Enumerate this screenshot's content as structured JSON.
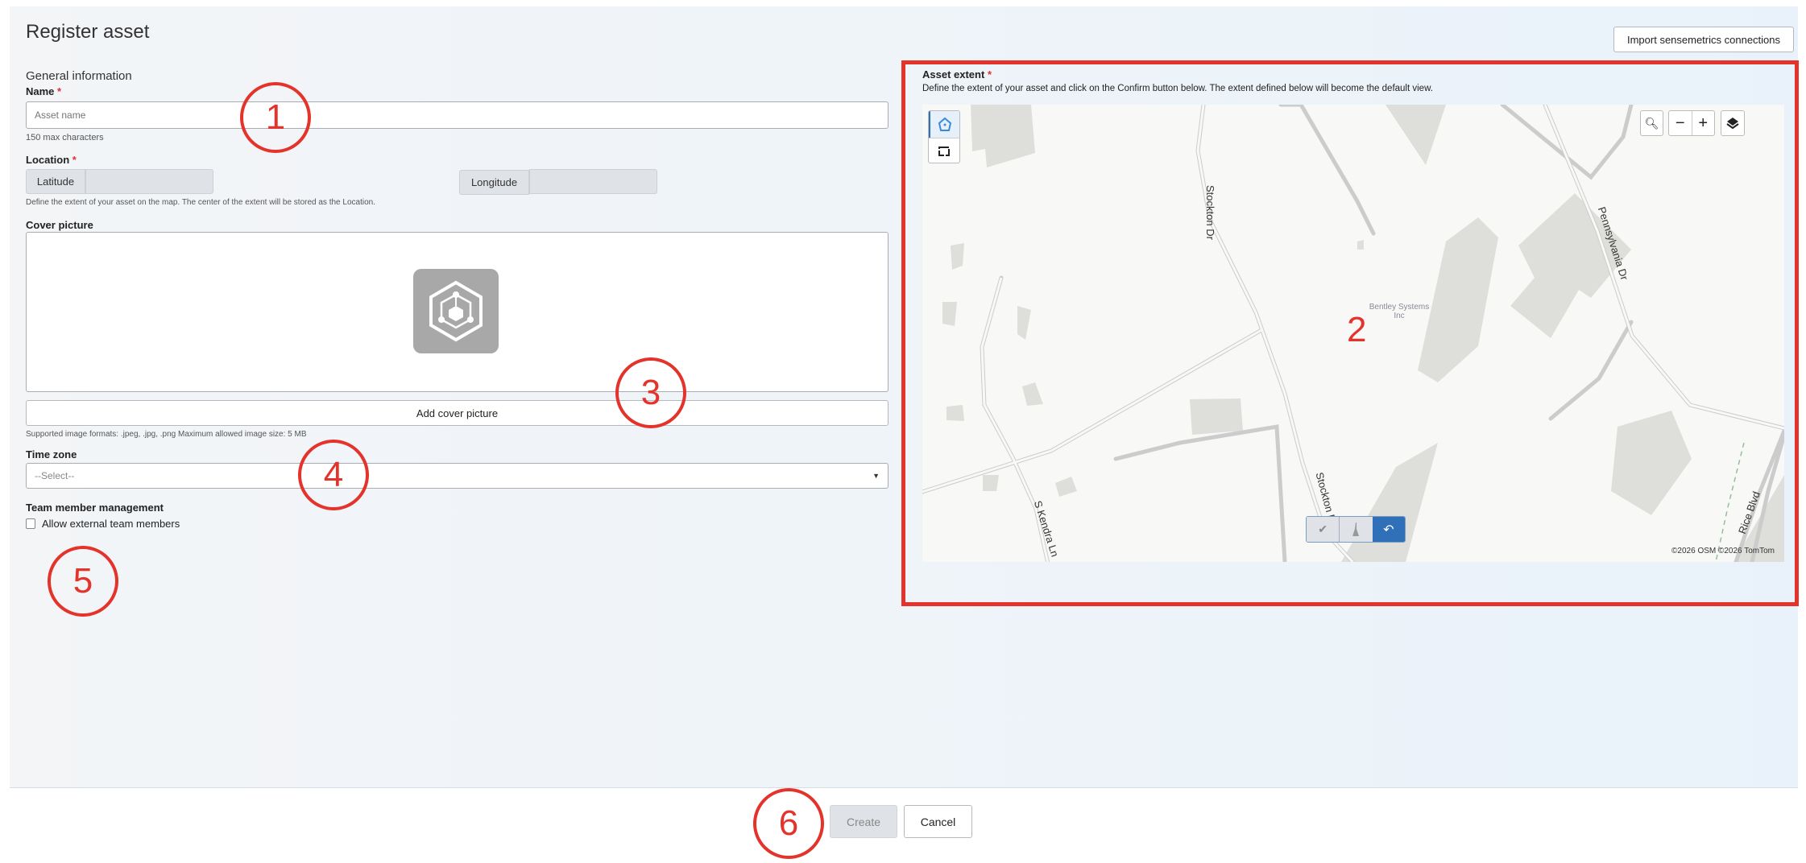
{
  "page": {
    "title": "Register asset",
    "import_button": "Import sensemetrics connections"
  },
  "form": {
    "section_title": "General information",
    "name": {
      "label": "Name",
      "required": "*",
      "placeholder": "Asset name",
      "hint": "150 max characters"
    },
    "location": {
      "label": "Location",
      "required": "*",
      "latitude_label": "Latitude",
      "latitude_value": "",
      "longitude_label": "Longitude",
      "longitude_value": "",
      "hint": "Define the extent of your asset on the map. The center of the extent will be stored as the Location."
    },
    "cover": {
      "label": "Cover picture",
      "add_button": "Add cover picture",
      "hint": "Supported image formats: .jpeg, .jpg, .png Maximum allowed image size: 5 MB"
    },
    "timezone": {
      "label": "Time zone",
      "selected": "--Select--"
    },
    "team": {
      "label": "Team member management",
      "checkbox_label": "Allow external team members",
      "checked": false
    }
  },
  "extent": {
    "label": "Asset extent",
    "required": "*",
    "description": "Define the extent of your asset and click on the Confirm button below. The extent defined below will become the default view.",
    "map": {
      "labels": {
        "stockton1": "Stockton Dr",
        "stockton2": "Stockton Dr",
        "pennsylvania": "Pennsylvania Dr",
        "kendra": "S Kendra Ln",
        "rice": "Rice Blvd",
        "poi": "Bentley Systems Inc"
      },
      "attribution": "©2026 OSM ©2026 TomTom",
      "tools": [
        "polygon-icon",
        "rectangle-icon"
      ],
      "controls": {
        "zoom_out": "−",
        "zoom_in": "+"
      }
    }
  },
  "footer": {
    "create": "Create",
    "cancel": "Cancel"
  },
  "annotations": [
    "1",
    "2",
    "3",
    "4",
    "5",
    "6"
  ],
  "colors": {
    "annotation": "#e3332a",
    "primary": "#3070b8"
  }
}
